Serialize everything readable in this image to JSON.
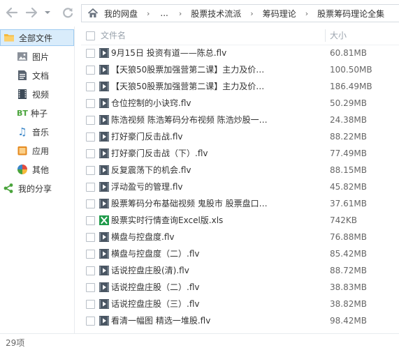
{
  "nav": {
    "back_icon": "arrow-left-icon",
    "forward_icon": "arrow-right-icon",
    "history_icon": "chevron-down-icon",
    "refresh_icon": "refresh-icon"
  },
  "breadcrumb": {
    "home_icon": "home-icon",
    "items": [
      "我的网盘",
      "...",
      "股票技术流派",
      "筹码理论",
      "股票筹码理论全集"
    ],
    "separator": "›"
  },
  "sidebar": {
    "items": [
      {
        "label": "全部文件",
        "icon": "folder-icon",
        "active": true,
        "color": "#f6b93b"
      },
      {
        "label": "图片",
        "icon": "image-icon",
        "active": false,
        "color": "#8a9099"
      },
      {
        "label": "文档",
        "icon": "document-icon",
        "active": false,
        "color": "#5a6470"
      },
      {
        "label": "视频",
        "icon": "film-icon",
        "active": false,
        "color": "#3d4a57"
      },
      {
        "label": "种子",
        "icon": "bt-icon",
        "glyph": "BT",
        "active": false,
        "color": "#4aa43c"
      },
      {
        "label": "音乐",
        "icon": "music-icon",
        "glyph": "♫",
        "active": false,
        "color": "#3a86c8"
      },
      {
        "label": "应用",
        "icon": "app-icon",
        "active": false,
        "color": "#e58a1f"
      },
      {
        "label": "其他",
        "icon": "other-icon",
        "active": false,
        "color": "#e24c3f"
      },
      {
        "label": "我的分享",
        "icon": "share-icon",
        "active": false,
        "color": "#4aa43c"
      }
    ]
  },
  "list": {
    "header": {
      "name": "文件名",
      "size": "大小"
    },
    "rows": [
      {
        "name": "9月15日 投资有道——陈总.flv",
        "size": "60.81MB",
        "type": "video"
      },
      {
        "name": "【天狼50股票加强营第二课】主力及价…",
        "size": "100.50MB",
        "type": "video"
      },
      {
        "name": "【天狼50股票加强营第二课】主力及价…",
        "size": "186.49MB",
        "type": "video"
      },
      {
        "name": "仓位控制的小诀窍.flv",
        "size": "50.29MB",
        "type": "video"
      },
      {
        "name": "陈浩视频 陈浩筹码分布视频 陈浩炒股一…",
        "size": "24.38MB",
        "type": "video"
      },
      {
        "name": "打好豪门反击战.flv",
        "size": "88.22MB",
        "type": "video"
      },
      {
        "name": "打好豪门反击战（下）.flv",
        "size": "77.49MB",
        "type": "video"
      },
      {
        "name": "反复震荡下的机会.flv",
        "size": "88.15MB",
        "type": "video"
      },
      {
        "name": "浮动盈亏的管理.flv",
        "size": "45.82MB",
        "type": "video"
      },
      {
        "name": "股票筹码分布基础视频 鬼股市 股票盘口…",
        "size": "37.61MB",
        "type": "video"
      },
      {
        "name": "股票实时行情查询Excel版.xls",
        "size": "742KB",
        "type": "excel"
      },
      {
        "name": "横盘与控盘度.flv",
        "size": "76.88MB",
        "type": "video"
      },
      {
        "name": "横盘与控盘度（二）.flv",
        "size": "85.42MB",
        "type": "video"
      },
      {
        "name": "话说控盘庄股(清).flv",
        "size": "88.72MB",
        "type": "video"
      },
      {
        "name": "话说控盘庄股（二）.flv",
        "size": "38.83MB",
        "type": "video"
      },
      {
        "name": "话说控盘庄股（三）.flv",
        "size": "38.82MB",
        "type": "video"
      },
      {
        "name": "看清一幅图 精选一堆股.flv",
        "size": "98.42MB",
        "type": "video"
      }
    ]
  },
  "status": {
    "count": "29项"
  },
  "colors": {
    "accent": "#2a8be6",
    "active_bg": "#d9ecfb",
    "video_icon": "#4a5663",
    "excel_icon": "#1f9a4a"
  }
}
